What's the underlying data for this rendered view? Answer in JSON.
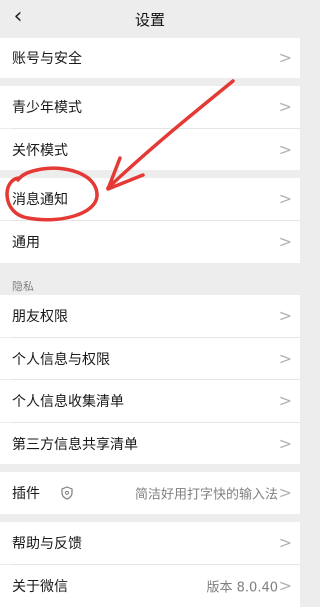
{
  "nav": {
    "title": "设置",
    "back_icon": "back-chevron-icon"
  },
  "rows": {
    "account": "账号与安全",
    "youth": "青少年模式",
    "care": "关怀模式",
    "notify": "消息通知",
    "general": "通用",
    "privacy_section": "隐私",
    "friend_perm": "朋友权限",
    "personal_info": "个人信息与权限",
    "collect_list": "个人信息收集清单",
    "third_party": "第三方信息共享清单",
    "plugins": "插件",
    "plugins_value": "简洁好用打字快的输入法",
    "help": "帮助与反馈",
    "about": "关于微信",
    "about_value": "版本 8.0.40"
  },
  "chevron": ">",
  "colors": {
    "annotation": "#e53935",
    "background": "#ededed",
    "cell": "#ffffff"
  }
}
